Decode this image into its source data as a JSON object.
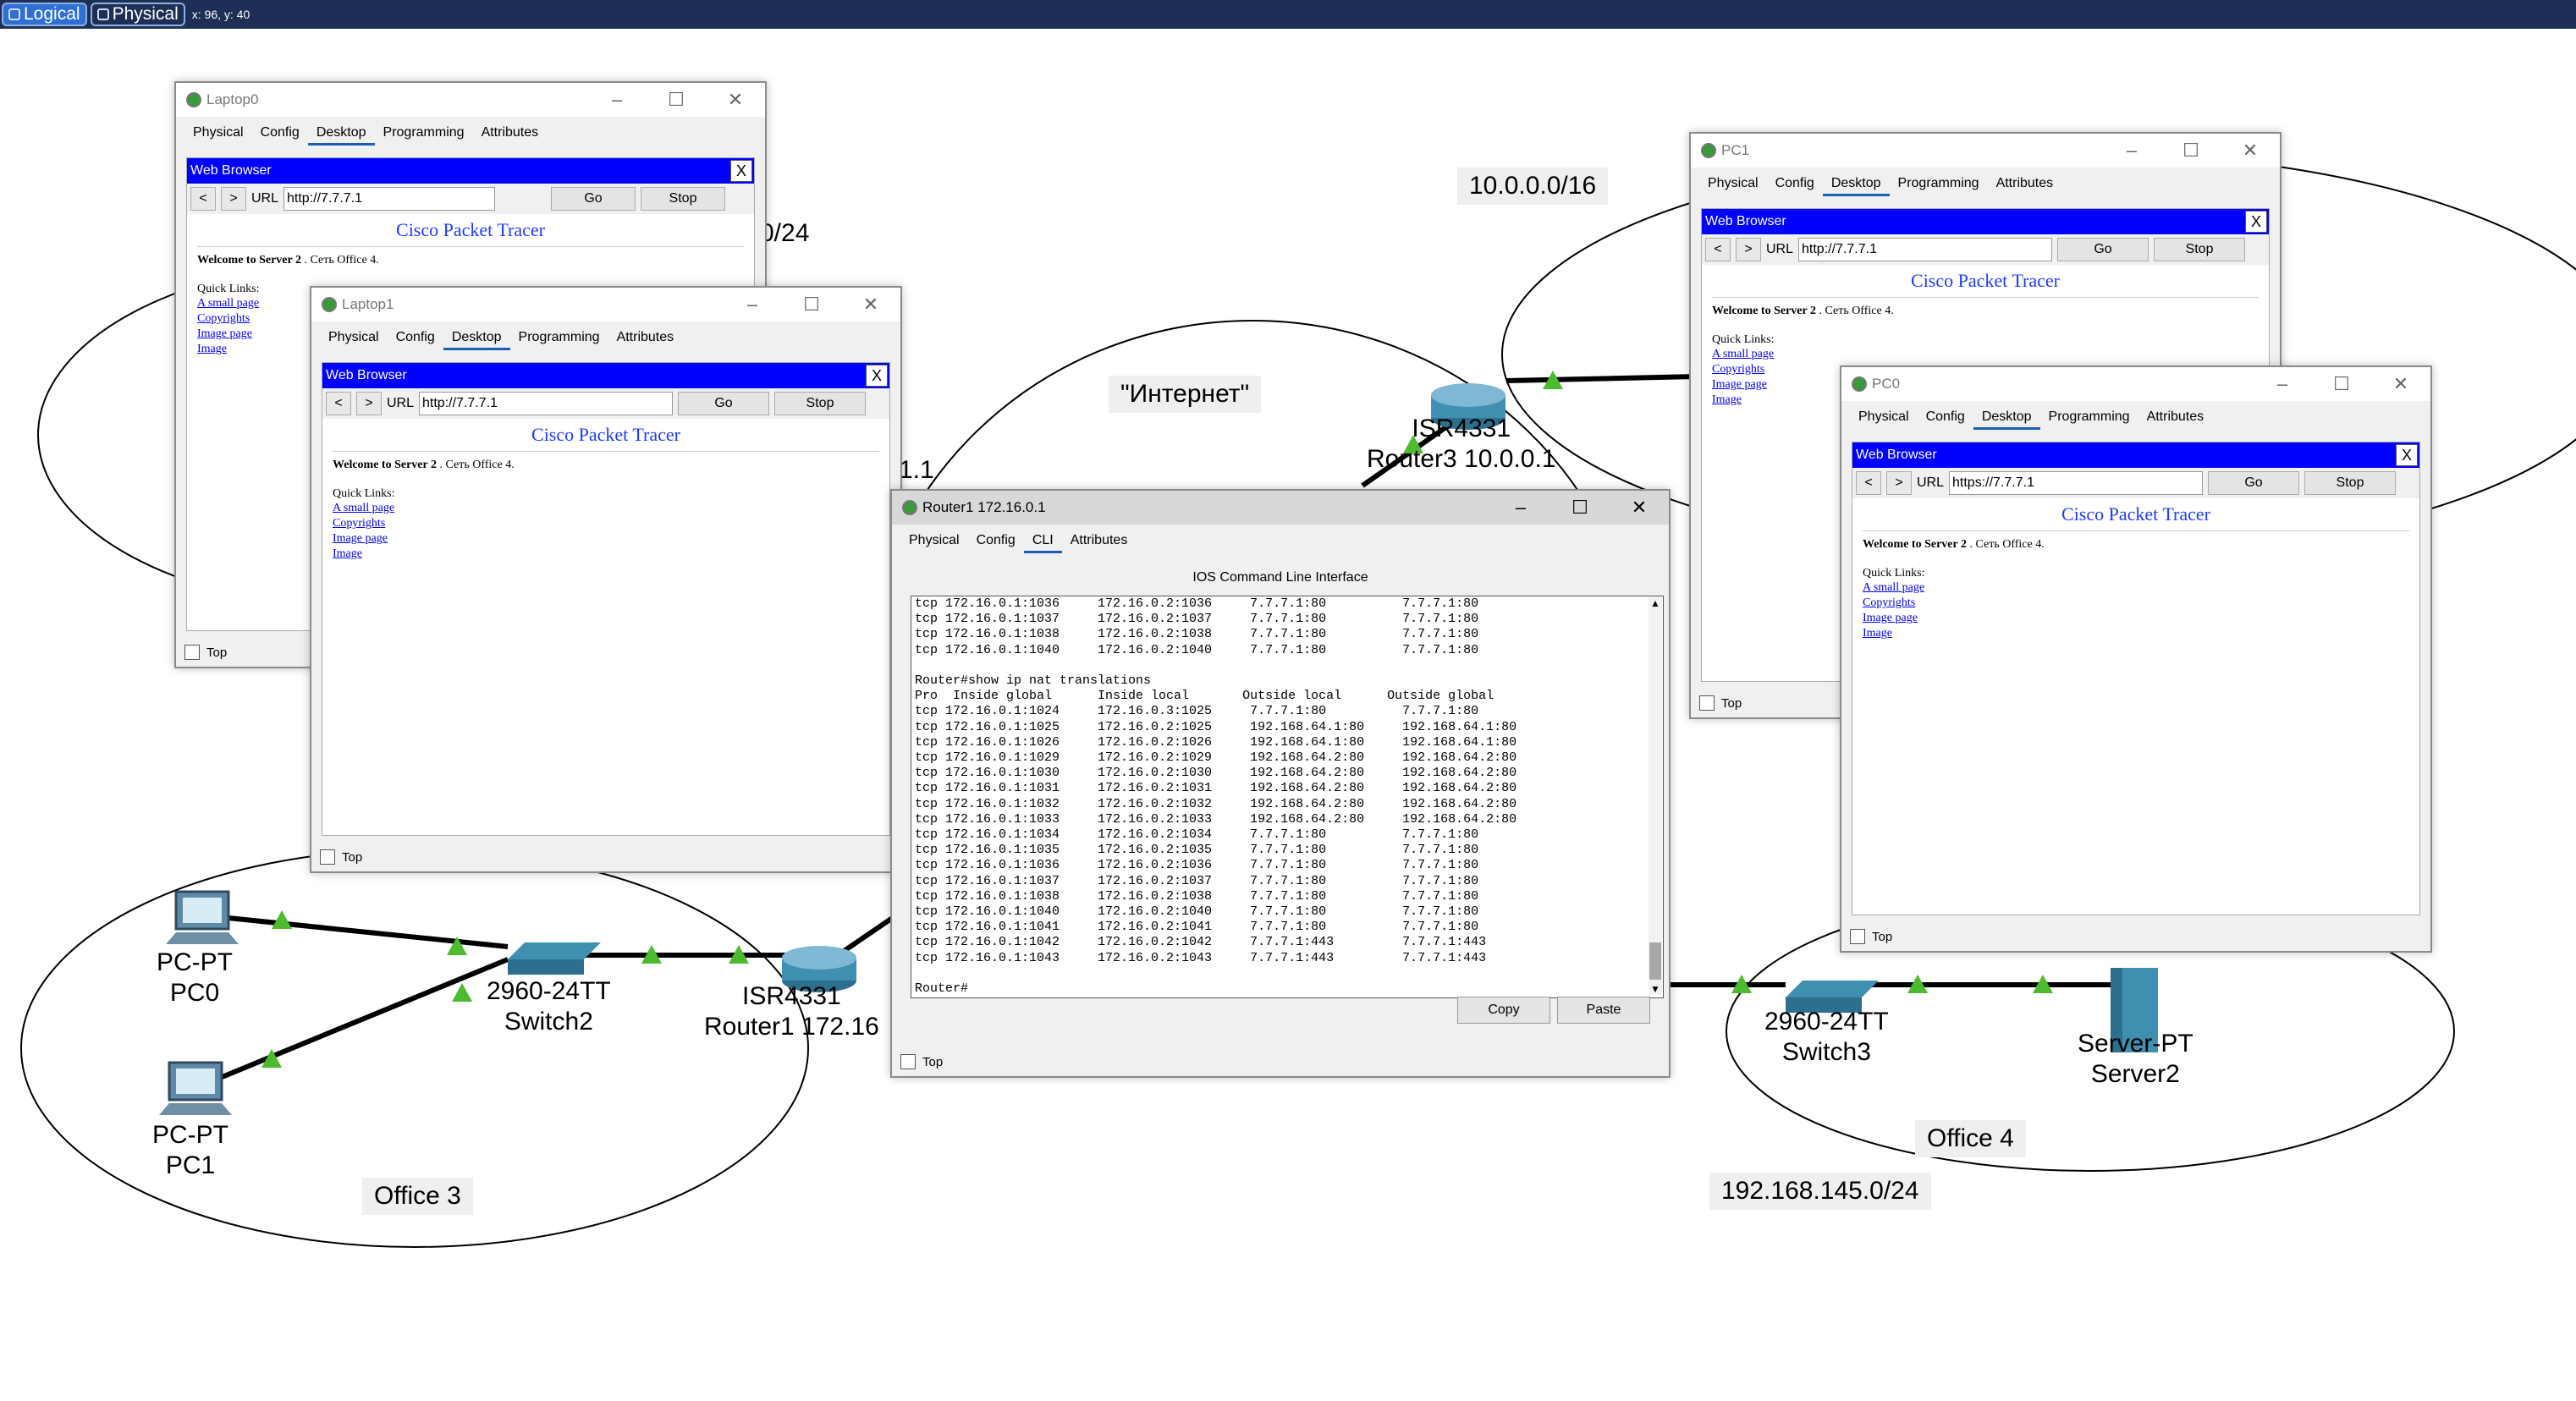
{
  "topbar": {
    "logical": "Logical",
    "physical": "Physical",
    "coords": "x: 96, y: 40"
  },
  "labels": {
    "net24": "0/24",
    "net16": "10.0.0.0/16",
    "internet": "\"Интернет\"",
    "router3": "ISR4331\nRouter3 10.0.0.1",
    "ip11": "1.1",
    "pc0": "PC-PT\nPC0",
    "pc1": "PC-PT\nPC1",
    "switch2": "2960-24TT\nSwitch2",
    "router1": "ISR4331\nRouter1 172.16",
    "office3": "Office 3",
    "switch3": "2960-24TT\nSwitch3",
    "server2": "Server-PT\nServer2",
    "office4": "Office 4",
    "net145": "192.168.145.0/24"
  },
  "browser": {
    "label": "Web Browser",
    "close": "X",
    "back": "<",
    "fwd": ">",
    "url_label": "URL",
    "go": "Go",
    "stop": "Stop",
    "title": "Cisco Packet Tracer",
    "welcome_bold": "Welcome to Server 2",
    "welcome_rest": " . Сеть Office 4.",
    "quick": "Quick Links:",
    "links": [
      "A small page",
      "Copyrights",
      "Image page",
      "Image"
    ],
    "top": "Top"
  },
  "tabs": {
    "physical": "Physical",
    "config": "Config",
    "desktop": "Desktop",
    "programming": "Programming",
    "attributes": "Attributes",
    "cli": "CLI"
  },
  "laptop0": {
    "title": "Laptop0",
    "url": "http://7.7.7.1"
  },
  "laptop1": {
    "title": "Laptop1",
    "url": "http://7.7.7.1"
  },
  "pc1win": {
    "title": "PC1",
    "url": "http://7.7.7.1"
  },
  "pc0win": {
    "title": "PC0",
    "url": "https://7.7.7.1"
  },
  "router1win": {
    "title": "Router1 172.16.0.1",
    "heading": "IOS Command Line Interface",
    "console": "tcp 172.16.0.1:1036     172.16.0.2:1036     7.7.7.1:80          7.7.7.1:80\ntcp 172.16.0.1:1037     172.16.0.2:1037     7.7.7.1:80          7.7.7.1:80\ntcp 172.16.0.1:1038     172.16.0.2:1038     7.7.7.1:80          7.7.7.1:80\ntcp 172.16.0.1:1040     172.16.0.2:1040     7.7.7.1:80          7.7.7.1:80\n\nRouter#show ip nat translations\nPro  Inside global      Inside local       Outside local      Outside global\ntcp 172.16.0.1:1024     172.16.0.3:1025     7.7.7.1:80          7.7.7.1:80\ntcp 172.16.0.1:1025     172.16.0.2:1025     192.168.64.1:80     192.168.64.1:80\ntcp 172.16.0.1:1026     172.16.0.2:1026     192.168.64.1:80     192.168.64.1:80\ntcp 172.16.0.1:1029     172.16.0.2:1029     192.168.64.2:80     192.168.64.2:80\ntcp 172.16.0.1:1030     172.16.0.2:1030     192.168.64.2:80     192.168.64.2:80\ntcp 172.16.0.1:1031     172.16.0.2:1031     192.168.64.2:80     192.168.64.2:80\ntcp 172.16.0.1:1032     172.16.0.2:1032     192.168.64.2:80     192.168.64.2:80\ntcp 172.16.0.1:1033     172.16.0.2:1033     192.168.64.2:80     192.168.64.2:80\ntcp 172.16.0.1:1034     172.16.0.2:1034     7.7.7.1:80          7.7.7.1:80\ntcp 172.16.0.1:1035     172.16.0.2:1035     7.7.7.1:80          7.7.7.1:80\ntcp 172.16.0.1:1036     172.16.0.2:1036     7.7.7.1:80          7.7.7.1:80\ntcp 172.16.0.1:1037     172.16.0.2:1037     7.7.7.1:80          7.7.7.1:80\ntcp 172.16.0.1:1038     172.16.0.2:1038     7.7.7.1:80          7.7.7.1:80\ntcp 172.16.0.1:1040     172.16.0.2:1040     7.7.7.1:80          7.7.7.1:80\ntcp 172.16.0.1:1041     172.16.0.2:1041     7.7.7.1:80          7.7.7.1:80\ntcp 172.16.0.1:1042     172.16.0.2:1042     7.7.7.1:443         7.7.7.1:443\ntcp 172.16.0.1:1043     172.16.0.2:1043     7.7.7.1:443         7.7.7.1:443\n\nRouter#",
    "copy": "Copy",
    "paste": "Paste"
  }
}
